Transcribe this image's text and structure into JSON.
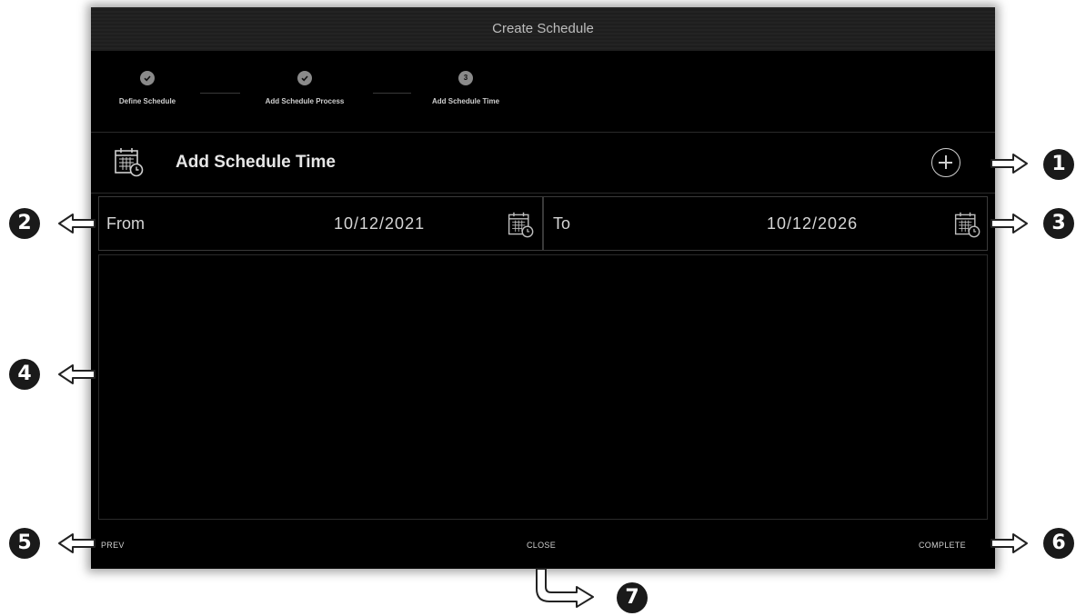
{
  "dialog": {
    "title": "Create Schedule"
  },
  "stepper": {
    "steps": [
      {
        "label": "Define Schedule",
        "state": "done"
      },
      {
        "label": "Add Schedule Process",
        "state": "done"
      },
      {
        "label": "Add Schedule Time",
        "state": "current",
        "number": "3"
      }
    ]
  },
  "section": {
    "title": "Add Schedule Time",
    "icon": "calendar-clock-icon",
    "add_icon": "plus-circle-icon"
  },
  "date_range": {
    "from_label": "From",
    "from_value": "10/12/2021",
    "to_label": "To",
    "to_value": "10/12/2026"
  },
  "footer": {
    "prev_label": "PREV",
    "close_label": "CLOSE",
    "complete_label": "COMPLETE"
  },
  "annotations": [
    "1",
    "2",
    "3",
    "4",
    "5",
    "6",
    "7"
  ],
  "colors": {
    "background": "#000000",
    "titlebar": "#1f1f1f",
    "text": "#d6d6d6",
    "step_dot": "#8a8a8a"
  }
}
